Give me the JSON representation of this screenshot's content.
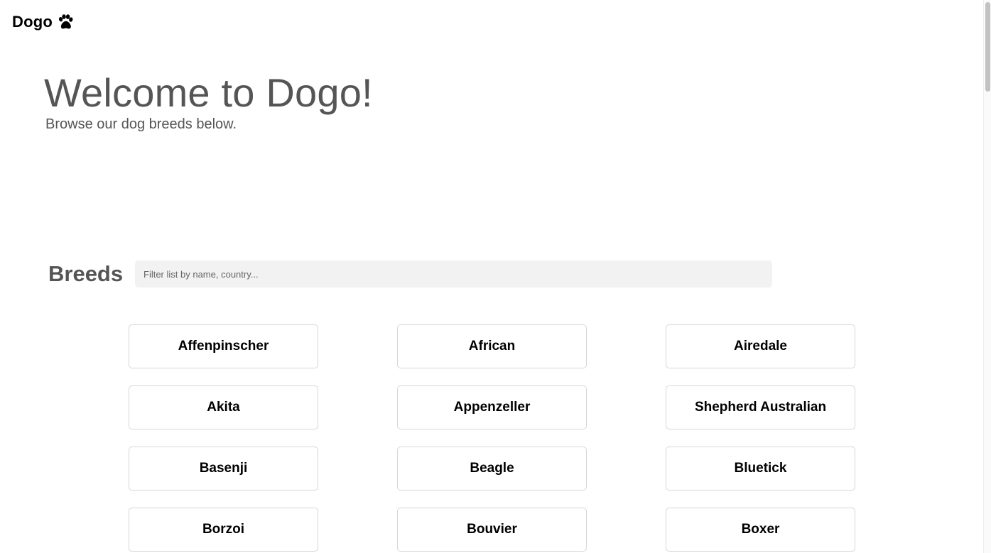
{
  "nav": {
    "brand": "Dogo",
    "brand_icon": "paw-icon"
  },
  "hero": {
    "title": "Welcome to Dogo!",
    "subtitle": "Browse our dog breeds below."
  },
  "breeds": {
    "heading": "Breeds",
    "filter_placeholder": "Filter list by name, country...",
    "filter_value": "",
    "items": [
      {
        "label": "Affenpinscher"
      },
      {
        "label": "African"
      },
      {
        "label": "Airedale"
      },
      {
        "label": "Akita"
      },
      {
        "label": "Appenzeller"
      },
      {
        "label": "Shepherd Australian"
      },
      {
        "label": "Basenji"
      },
      {
        "label": "Beagle"
      },
      {
        "label": "Bluetick"
      },
      {
        "label": "Borzoi"
      },
      {
        "label": "Bouvier"
      },
      {
        "label": "Boxer"
      }
    ]
  },
  "colors": {
    "text_muted": "#555555",
    "card_border": "#d6d6d6",
    "input_bg": "#f2f2f2"
  }
}
